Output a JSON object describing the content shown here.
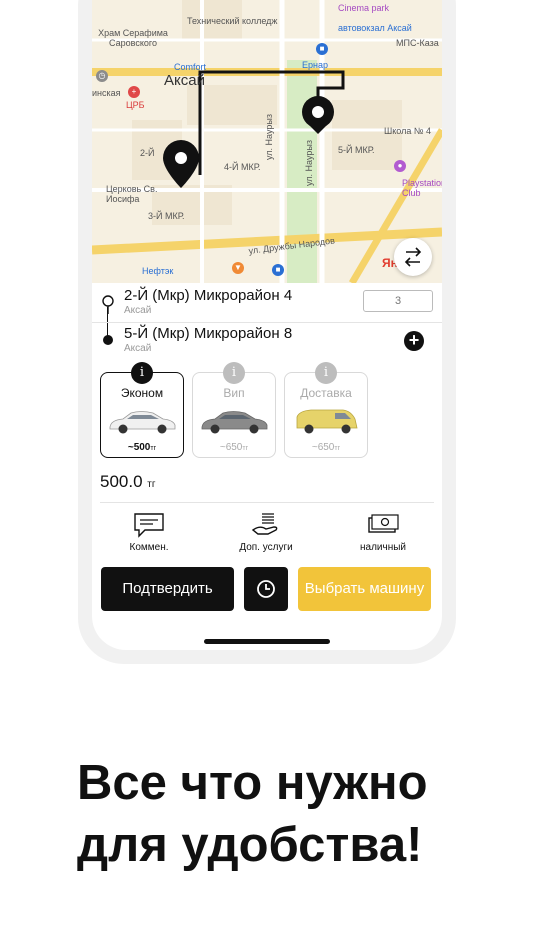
{
  "map": {
    "labels": {
      "college": "Технический колледж",
      "church1": "Храм Серафима Саровского",
      "comfort": "Comfort",
      "city": "Аксай",
      "crb": "ЦРБ",
      "crb_prefix": "инская",
      "cinema": "Cinema park",
      "bus": "автовокзал Аксай",
      "mps": "МПС-Каза",
      "ernar": "Ернар",
      "school": "Школа № 4",
      "mkr5": "5-Й МКР.",
      "mkr4": "4-Й МКР.",
      "mkr2": "2-Й",
      "mkr3": "3-Й МКР.",
      "playstation": "Playstation Club",
      "church2": "Церковь Св. Иосифа",
      "nauryz1": "ул. Наурыз",
      "nauryz2": "ул. Наурыз",
      "friendship": "ул. Дружбы Народов",
      "neftek": "Нефтэк"
    },
    "yandex_logo": "Ян"
  },
  "route": {
    "from": {
      "title": "2-Й (Мкр) Микрорайон 4",
      "subtitle": "Аксай",
      "entrance": "3"
    },
    "to": {
      "title": "5-Й (Мкр) Микрорайон 8",
      "subtitle": "Аксай"
    },
    "add_stop_glyph": "+"
  },
  "tariffs": [
    {
      "name": "Эконом",
      "price_prefix": "~",
      "price": "500",
      "currency": "тг",
      "info": "i",
      "selected": true,
      "car_color": "#e8e8e8"
    },
    {
      "name": "Вип",
      "price_prefix": "~",
      "price": "650",
      "currency": "тг",
      "info": "i",
      "selected": false,
      "car_color": "#8a8a8a"
    },
    {
      "name": "Доставка",
      "price_prefix": "~",
      "price": "650",
      "currency": "тг",
      "info": "i",
      "selected": false,
      "car_color": "#e6d36a"
    }
  ],
  "total": {
    "amount": "500.0",
    "currency": "тг"
  },
  "options": {
    "comment": "Коммен.",
    "extra": "Доп. услуги",
    "payment": "наличный"
  },
  "buttons": {
    "confirm": "Подтвердить",
    "choose_car": "Выбрать машину"
  },
  "headline": {
    "line1": "Все что нужно",
    "line2": "для удобства!"
  },
  "colors": {
    "accent_yellow": "#f2c43a",
    "dark": "#111111",
    "map_bg": "#f6f0e1",
    "road_yellow": "#f5d36a"
  }
}
